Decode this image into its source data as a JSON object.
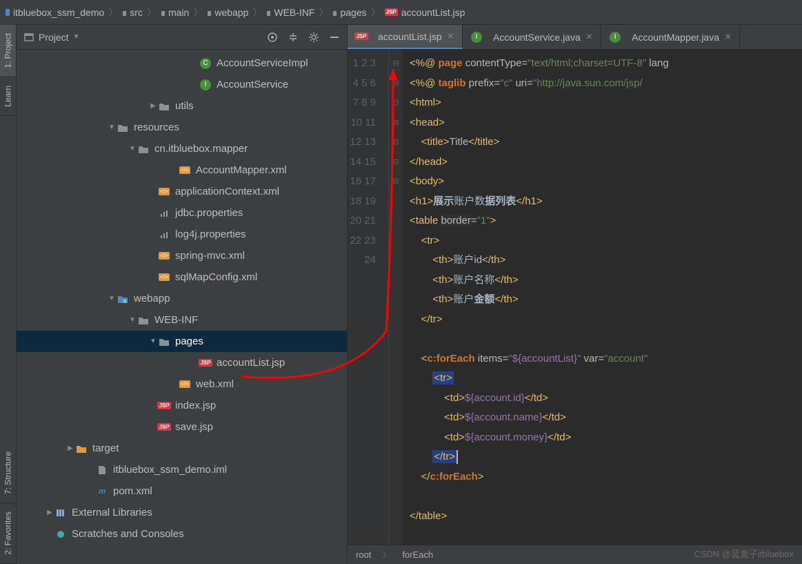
{
  "breadcrumb": [
    {
      "icon": "module",
      "label": "itbluebox_ssm_demo"
    },
    {
      "icon": "folder",
      "label": "src"
    },
    {
      "icon": "folder",
      "label": "main"
    },
    {
      "icon": "folder",
      "label": "webapp"
    },
    {
      "icon": "folder",
      "label": "WEB-INF"
    },
    {
      "icon": "folder",
      "label": "pages"
    },
    {
      "icon": "jsp",
      "label": "accountList.jsp"
    }
  ],
  "leftTabs": [
    {
      "label": "1: Project",
      "active": true
    },
    {
      "label": "Learn",
      "active": false
    },
    {
      "label": "7: Structure",
      "active": false
    },
    {
      "label": "2: Favorites",
      "active": false
    }
  ],
  "panel": {
    "title": "Project"
  },
  "tree": [
    {
      "indent": 210,
      "icon": "class",
      "label": "AccountServiceImpl"
    },
    {
      "indent": 210,
      "icon": "interface",
      "label": "AccountService"
    },
    {
      "indent": 150,
      "toggle": "▶",
      "icon": "folder",
      "label": "utils"
    },
    {
      "indent": 90,
      "toggle": "▼",
      "icon": "folder",
      "label": "resources"
    },
    {
      "indent": 120,
      "toggle": "▼",
      "icon": "folder",
      "label": "cn.itbluebox.mapper"
    },
    {
      "indent": 180,
      "icon": "xml",
      "label": "AccountMapper.xml"
    },
    {
      "indent": 150,
      "icon": "xml",
      "label": "applicationContext.xml"
    },
    {
      "indent": 150,
      "icon": "prop",
      "label": "jdbc.properties"
    },
    {
      "indent": 150,
      "icon": "prop",
      "label": "log4j.properties"
    },
    {
      "indent": 150,
      "icon": "xml",
      "label": "spring-mvc.xml"
    },
    {
      "indent": 150,
      "icon": "xml",
      "label": "sqlMapConfig.xml"
    },
    {
      "indent": 90,
      "toggle": "▼",
      "icon": "folder-web",
      "label": "webapp"
    },
    {
      "indent": 120,
      "toggle": "▼",
      "icon": "folder",
      "label": "WEB-INF"
    },
    {
      "indent": 150,
      "toggle": "▼",
      "icon": "folder",
      "label": "pages",
      "selected": true
    },
    {
      "indent": 210,
      "icon": "jsp",
      "label": "accountList.jsp"
    },
    {
      "indent": 180,
      "icon": "xml",
      "label": "web.xml"
    },
    {
      "indent": 150,
      "icon": "jsp",
      "label": "index.jsp"
    },
    {
      "indent": 150,
      "icon": "jsp",
      "label": "save.jsp"
    },
    {
      "indent": 30,
      "toggle": "▶",
      "icon": "folder-target",
      "label": "target"
    },
    {
      "indent": 60,
      "icon": "file",
      "label": "itbluebox_ssm_demo.iml"
    },
    {
      "indent": 60,
      "icon": "maven",
      "label": "pom.xml"
    },
    {
      "indent": 0,
      "toggle": "▶",
      "icon": "lib",
      "label": "External Libraries"
    },
    {
      "indent": 0,
      "icon": "scratch",
      "label": "Scratches and Consoles"
    }
  ],
  "editorTabs": [
    {
      "icon": "jsp",
      "label": "accountList.jsp",
      "active": true,
      "closeable": true
    },
    {
      "icon": "interface",
      "label": "AccountService.java",
      "active": false,
      "closeable": true
    },
    {
      "icon": "interface",
      "label": "AccountMapper.java",
      "active": false,
      "closeable": true
    }
  ],
  "gutterStart": 1,
  "gutterEnd": 24,
  "bottomCrumbs": [
    "root",
    "forEach"
  ],
  "watermark": "CSDN @蓝盒子itbluebox",
  "chart_data": {
    "type": "table",
    "title": "accountList.jsp source",
    "lines": [
      "<%@ page contentType=\"text/html;charset=UTF-8\" lang",
      "<%@ taglib prefix=\"c\" uri=\"http://java.sun.com/jsp/",
      "<html>",
      "<head>",
      "    <title>Title</title>",
      "</head>",
      "<body>",
      "<h1>展示账户数据列表</h1>",
      "<table border=\"1\">",
      "    <tr>",
      "        <th>账户id</th>",
      "        <th>账户名称</th>",
      "        <th>账户金额</th>",
      "    </tr>",
      "",
      "    <c:forEach items=\"${accountList}\" var=\"account\"",
      "        <tr>",
      "            <td>${account.id}</td>",
      "            <td>${account.name}</td>",
      "            <td>${account.money}</td>",
      "        </tr>",
      "    </c:forEach>",
      "",
      "</table>"
    ]
  }
}
